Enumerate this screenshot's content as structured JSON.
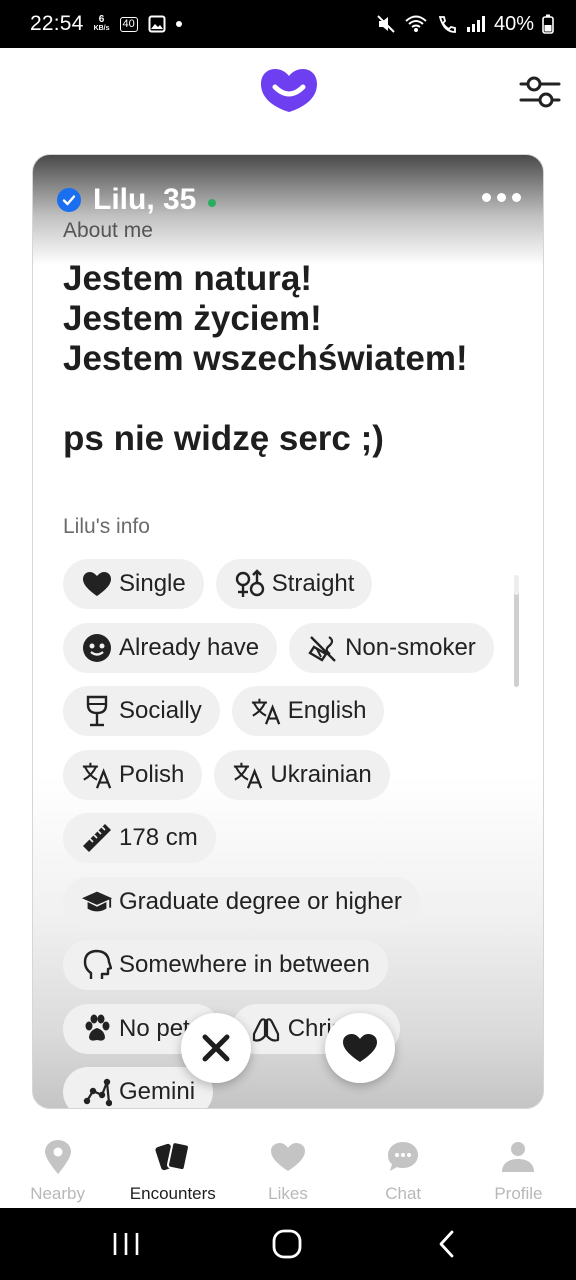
{
  "status_bar": {
    "time": "22:54",
    "net_speed": "6",
    "net_unit": "KB/s",
    "badge": "40",
    "battery": "40%"
  },
  "colors": {
    "brand": "#6e3ff0",
    "verified": "#1a6ff0",
    "online": "#27ae60",
    "chip_bg": "#f0f0f0"
  },
  "profile": {
    "name_age": "Lilu, 35",
    "about_label": "About me",
    "about_text": "Jestem naturą!\nJestem życiem!\nJestem wszechświatem!\n\nps nie widzę serc ;)",
    "info_label": "Lilu's info",
    "chips": {
      "relationship": "Single",
      "orientation": "Straight",
      "kids": "Already have",
      "smoking": "Non-smoker",
      "drinking": "Socially",
      "lang1": "English",
      "lang2": "Polish",
      "lang3": "Ukrainian",
      "height": "178 cm",
      "education": "Graduate degree or higher",
      "personality": "Somewhere in between",
      "pets": "No pets",
      "religion": "Christian",
      "zodiac": "Gemini"
    }
  },
  "nav": {
    "nearby": "Nearby",
    "encounters": "Encounters",
    "likes": "Likes",
    "chat": "Chat",
    "profile": "Profile"
  }
}
